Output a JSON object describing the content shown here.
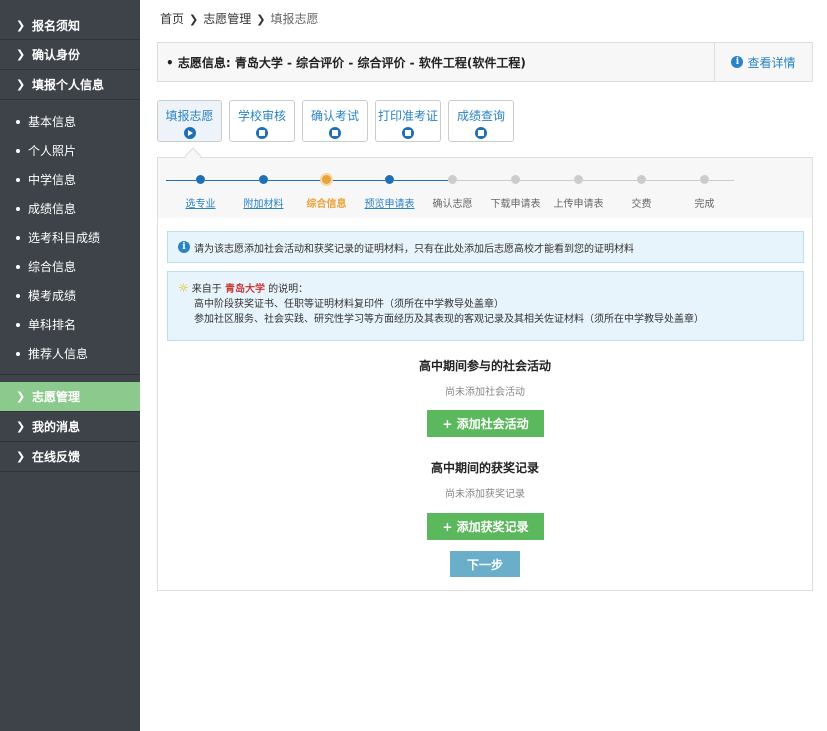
{
  "sidebar": {
    "top_items": [
      {
        "label": "报名须知"
      },
      {
        "label": "确认身份"
      },
      {
        "label": "填报个人信息"
      }
    ],
    "sub_items": [
      {
        "label": "基本信息"
      },
      {
        "label": "个人照片"
      },
      {
        "label": "中学信息"
      },
      {
        "label": "成绩信息"
      },
      {
        "label": "选考科目成绩"
      },
      {
        "label": "综合信息"
      },
      {
        "label": "模考成绩"
      },
      {
        "label": "单科排名"
      },
      {
        "label": "推荐人信息"
      }
    ],
    "bottom_items": [
      {
        "label": "志愿管理",
        "active": true
      },
      {
        "label": "我的消息"
      },
      {
        "label": "在线反馈"
      }
    ]
  },
  "breadcrumb": {
    "home": "首页",
    "section": "志愿管理",
    "current": "填报志愿"
  },
  "info_bar": {
    "label": "志愿信息:  青岛大学 - 综合评价 - 综合评价 - 软件工程(软件工程)",
    "detail": "查看详情"
  },
  "tabs": [
    {
      "label": "填报志愿",
      "active": true
    },
    {
      "label": "学校审核"
    },
    {
      "label": "确认考试"
    },
    {
      "label": "打印准考证"
    },
    {
      "label": "成绩查询"
    }
  ],
  "steps": [
    {
      "label": "选专业",
      "state": "done"
    },
    {
      "label": "附加材料",
      "state": "done"
    },
    {
      "label": "综合信息",
      "state": "current"
    },
    {
      "label": "预览申请表",
      "state": "done"
    },
    {
      "label": "确认志愿",
      "state": "todo"
    },
    {
      "label": "下载申请表",
      "state": "todo"
    },
    {
      "label": "上传申请表",
      "state": "todo"
    },
    {
      "label": "交费",
      "state": "todo"
    },
    {
      "label": "完成",
      "state": "todo"
    }
  ],
  "tips": {
    "tip1": "请为该志愿添加社会活动和获奖记录的证明材料，只有在此处添加后志愿高校才能看到您的证明材料",
    "tip2_prefix": "来自于 ",
    "tip2_school": "青岛大学",
    "tip2_suffix": " 的说明：",
    "tip2_line1": "高中阶段获奖证书、任职等证明材料复印件（须所在中学教导处盖章）",
    "tip2_line2": "参加社区服务、社会实践、研究性学习等方面经历及其表现的客观记录及其相关佐证材料（须所在中学教导处盖章）"
  },
  "activities": {
    "title": "高中期间参与的社会活动",
    "empty": "尚未添加社会活动",
    "button": "+ 添加社会活动"
  },
  "awards": {
    "title": "高中期间的获奖记录",
    "empty": "尚未添加获奖记录",
    "button": "+ 添加获奖记录"
  },
  "next_button": "下一步",
  "colors": {
    "sidebar_bg": "#3d4349",
    "sidebar_active": "#8cc98c",
    "link_blue": "#2a83c4",
    "step_done": "#1f6fb5",
    "step_current": "#e8a33a",
    "step_todo": "#cccccc",
    "green_button": "#5cb85c",
    "next_button": "#6aaec9"
  }
}
